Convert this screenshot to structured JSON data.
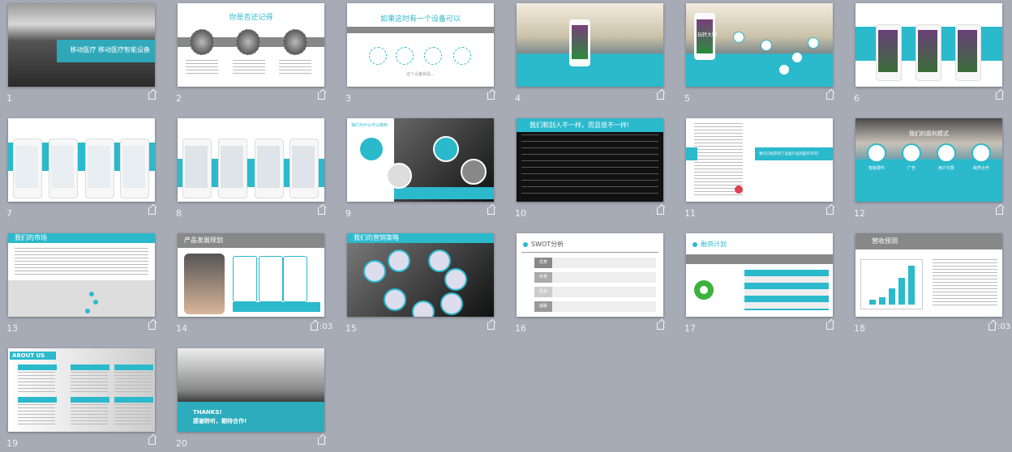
{
  "accent": "#2bb9cc",
  "slides": [
    {
      "n": "1",
      "title": "移动医疗  移动医疗智能设备",
      "kind": "cover"
    },
    {
      "n": "2",
      "title": "你是否还记得",
      "kind": "remember"
    },
    {
      "n": "3",
      "title": "如果这时有一个设备可以",
      "footer": "这个设备就是...",
      "kind": "device"
    },
    {
      "n": "4",
      "kind": "app1"
    },
    {
      "n": "5",
      "app": "玩转大咖",
      "kind": "app2"
    },
    {
      "n": "6",
      "kind": "app3"
    },
    {
      "n": "7",
      "kind": "app4"
    },
    {
      "n": "8",
      "kind": "app5"
    },
    {
      "n": "9",
      "title": "我们为什么可以做到",
      "kind": "why"
    },
    {
      "n": "10",
      "title": "我们和别人不一样，而且很不一样!",
      "kind": "compare"
    },
    {
      "n": "11",
      "title": "我们已经获得了该类产品的医疗许可!",
      "kind": "license"
    },
    {
      "n": "12",
      "title": "我们的盈利模式",
      "items": [
        "智能硬件",
        "广告",
        "用户付费",
        "跨界合作"
      ],
      "kind": "profit"
    },
    {
      "n": "13",
      "title": "我们的市场",
      "kind": "market"
    },
    {
      "n": "14",
      "title": "产品发展规划",
      "duration": ":03",
      "kind": "plan"
    },
    {
      "n": "15",
      "title": "我们的营销策略",
      "kind": "marketing"
    },
    {
      "n": "16",
      "title": "SWOT分析",
      "items": [
        "优势",
        "劣势",
        "机会",
        "威胁"
      ],
      "kind": "swot"
    },
    {
      "n": "17",
      "title": "融资计划",
      "kind": "finance"
    },
    {
      "n": "18",
      "title": "营收预测",
      "duration": ":03",
      "kind": "revenue"
    },
    {
      "n": "19",
      "title": "ABOUT US",
      "kind": "about"
    },
    {
      "n": "20",
      "title": "THANKS!",
      "subtitle": "感谢聆听，期待合作!",
      "kind": "thanks"
    }
  ]
}
